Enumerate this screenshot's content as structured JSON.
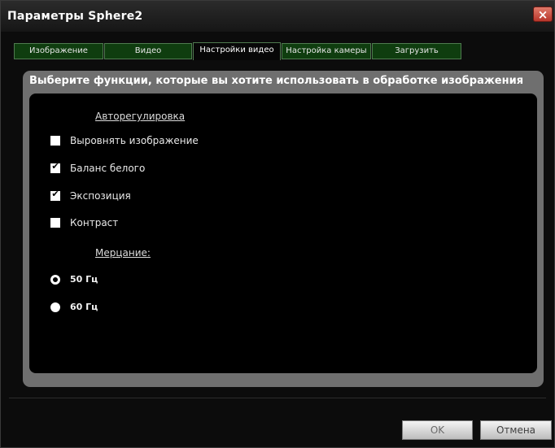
{
  "window": {
    "title": "Параметры Sphere2",
    "close_label": "×"
  },
  "tabs": [
    {
      "label": "Изображение",
      "active": false
    },
    {
      "label": "Видео",
      "active": false
    },
    {
      "label": "Настройки видео",
      "active": true
    },
    {
      "label": "Настройка камеры",
      "active": false
    },
    {
      "label": "Загрузить",
      "active": false
    }
  ],
  "panel": {
    "heading": "Выберите функции, которые вы хотите использовать в обработке изображения",
    "autoadjust": {
      "label": "Авторегулировка",
      "options": [
        {
          "label": "Выровнять изображение",
          "checked": false
        },
        {
          "label": "Баланс белого",
          "checked": true
        },
        {
          "label": "Экспозиция",
          "checked": true
        },
        {
          "label": "Контраст",
          "checked": false
        }
      ]
    },
    "flicker": {
      "label": "Мерцание:",
      "options": [
        {
          "label": "50 Гц",
          "selected": true
        },
        {
          "label": "60 Гц",
          "selected": false
        }
      ]
    }
  },
  "buttons": {
    "ok": "OK",
    "cancel": "Отмена"
  },
  "colors": {
    "tab_bg": "#0f3d0f",
    "panel": "#6f6f6f",
    "window_bg": "#0c0c0c"
  }
}
